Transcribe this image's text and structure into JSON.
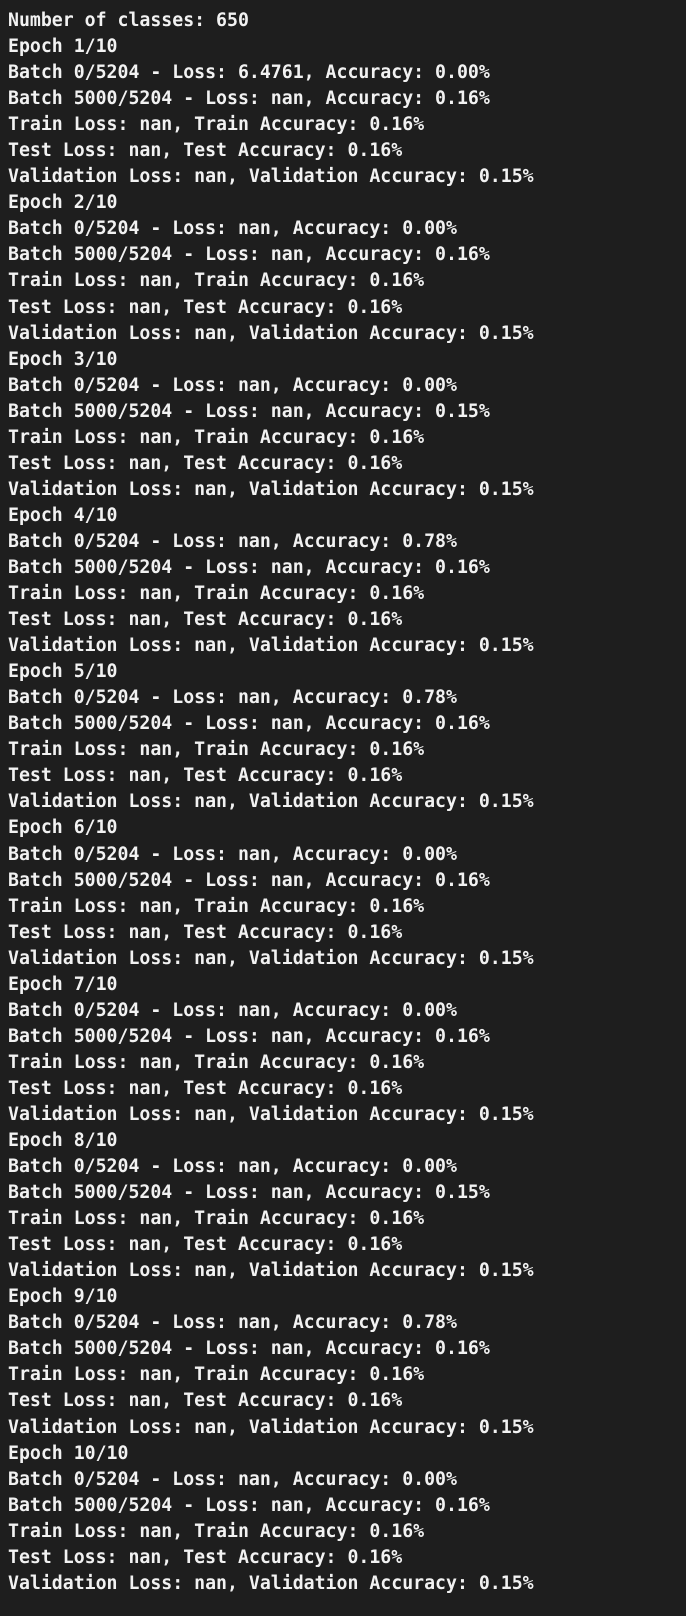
{
  "output": {
    "header": "Number of classes: 650",
    "epochs": [
      {
        "epoch": "Epoch 1/10",
        "batch_first": "Batch 0/5204 - Loss: 6.4761, Accuracy: 0.00%",
        "batch_last": "Batch 5000/5204 - Loss: nan, Accuracy: 0.16%",
        "train": "Train Loss: nan, Train Accuracy: 0.16%",
        "test": "Test Loss: nan, Test Accuracy: 0.16%",
        "validation": "Validation Loss: nan, Validation Accuracy: 0.15%"
      },
      {
        "epoch": "Epoch 2/10",
        "batch_first": "Batch 0/5204 - Loss: nan, Accuracy: 0.00%",
        "batch_last": "Batch 5000/5204 - Loss: nan, Accuracy: 0.16%",
        "train": "Train Loss: nan, Train Accuracy: 0.16%",
        "test": "Test Loss: nan, Test Accuracy: 0.16%",
        "validation": "Validation Loss: nan, Validation Accuracy: 0.15%"
      },
      {
        "epoch": "Epoch 3/10",
        "batch_first": "Batch 0/5204 - Loss: nan, Accuracy: 0.00%",
        "batch_last": "Batch 5000/5204 - Loss: nan, Accuracy: 0.15%",
        "train": "Train Loss: nan, Train Accuracy: 0.16%",
        "test": "Test Loss: nan, Test Accuracy: 0.16%",
        "validation": "Validation Loss: nan, Validation Accuracy: 0.15%"
      },
      {
        "epoch": "Epoch 4/10",
        "batch_first": "Batch 0/5204 - Loss: nan, Accuracy: 0.78%",
        "batch_last": "Batch 5000/5204 - Loss: nan, Accuracy: 0.16%",
        "train": "Train Loss: nan, Train Accuracy: 0.16%",
        "test": "Test Loss: nan, Test Accuracy: 0.16%",
        "validation": "Validation Loss: nan, Validation Accuracy: 0.15%"
      },
      {
        "epoch": "Epoch 5/10",
        "batch_first": "Batch 0/5204 - Loss: nan, Accuracy: 0.78%",
        "batch_last": "Batch 5000/5204 - Loss: nan, Accuracy: 0.16%",
        "train": "Train Loss: nan, Train Accuracy: 0.16%",
        "test": "Test Loss: nan, Test Accuracy: 0.16%",
        "validation": "Validation Loss: nan, Validation Accuracy: 0.15%"
      },
      {
        "epoch": "Epoch 6/10",
        "batch_first": "Batch 0/5204 - Loss: nan, Accuracy: 0.00%",
        "batch_last": "Batch 5000/5204 - Loss: nan, Accuracy: 0.16%",
        "train": "Train Loss: nan, Train Accuracy: 0.16%",
        "test": "Test Loss: nan, Test Accuracy: 0.16%",
        "validation": "Validation Loss: nan, Validation Accuracy: 0.15%"
      },
      {
        "epoch": "Epoch 7/10",
        "batch_first": "Batch 0/5204 - Loss: nan, Accuracy: 0.00%",
        "batch_last": "Batch 5000/5204 - Loss: nan, Accuracy: 0.16%",
        "train": "Train Loss: nan, Train Accuracy: 0.16%",
        "test": "Test Loss: nan, Test Accuracy: 0.16%",
        "validation": "Validation Loss: nan, Validation Accuracy: 0.15%"
      },
      {
        "epoch": "Epoch 8/10",
        "batch_first": "Batch 0/5204 - Loss: nan, Accuracy: 0.00%",
        "batch_last": "Batch 5000/5204 - Loss: nan, Accuracy: 0.15%",
        "train": "Train Loss: nan, Train Accuracy: 0.16%",
        "test": "Test Loss: nan, Test Accuracy: 0.16%",
        "validation": "Validation Loss: nan, Validation Accuracy: 0.15%"
      },
      {
        "epoch": "Epoch 9/10",
        "batch_first": "Batch 0/5204 - Loss: nan, Accuracy: 0.78%",
        "batch_last": "Batch 5000/5204 - Loss: nan, Accuracy: 0.16%",
        "train": "Train Loss: nan, Train Accuracy: 0.16%",
        "test": "Test Loss: nan, Test Accuracy: 0.16%",
        "validation": "Validation Loss: nan, Validation Accuracy: 0.15%"
      },
      {
        "epoch": "Epoch 10/10",
        "batch_first": "Batch 0/5204 - Loss: nan, Accuracy: 0.00%",
        "batch_last": "Batch 5000/5204 - Loss: nan, Accuracy: 0.16%",
        "train": "Train Loss: nan, Train Accuracy: 0.16%",
        "test": "Test Loss: nan, Test Accuracy: 0.16%",
        "validation": "Validation Loss: nan, Validation Accuracy: 0.15%"
      }
    ]
  }
}
